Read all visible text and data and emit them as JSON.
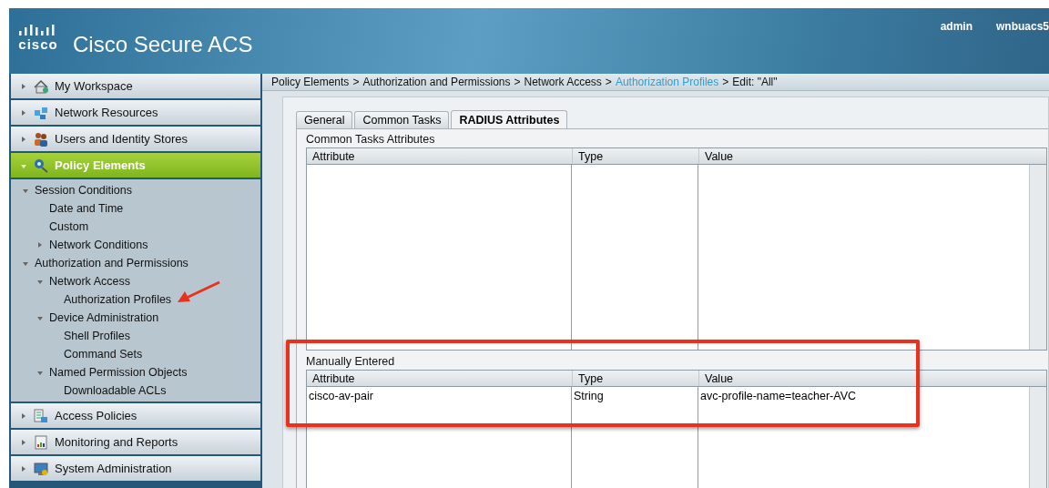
{
  "header": {
    "logo_text": "cisco",
    "title": "Cisco Secure ACS",
    "user": "admin",
    "server": "wnbuacs5"
  },
  "sidebar": {
    "sections": [
      {
        "label": "My Workspace",
        "expanded": false,
        "selected": false
      },
      {
        "label": "Network Resources",
        "expanded": false,
        "selected": false
      },
      {
        "label": "Users and Identity Stores",
        "expanded": false,
        "selected": false
      },
      {
        "label": "Policy Elements",
        "expanded": true,
        "selected": true,
        "children": [
          {
            "label": "Session Conditions",
            "expanded": true,
            "children": [
              {
                "label": "Date and Time"
              },
              {
                "label": "Custom"
              },
              {
                "label": "Network Conditions",
                "expanded": false
              }
            ]
          },
          {
            "label": "Authorization and Permissions",
            "expanded": true,
            "children": [
              {
                "label": "Network Access",
                "expanded": true,
                "children": [
                  {
                    "label": "Authorization Profiles",
                    "pointed": true
                  }
                ]
              },
              {
                "label": "Device Administration",
                "expanded": true,
                "children": [
                  {
                    "label": "Shell Profiles"
                  },
                  {
                    "label": "Command Sets"
                  }
                ]
              },
              {
                "label": "Named Permission Objects",
                "expanded": true,
                "children": [
                  {
                    "label": "Downloadable ACLs"
                  }
                ]
              }
            ]
          }
        ]
      },
      {
        "label": "Access Policies",
        "expanded": false,
        "selected": false
      },
      {
        "label": "Monitoring and Reports",
        "expanded": false,
        "selected": false
      },
      {
        "label": "System Administration",
        "expanded": false,
        "selected": false
      }
    ]
  },
  "breadcrumb": [
    {
      "kind": "text",
      "text": "Policy Elements"
    },
    {
      "kind": "separator",
      "text": ">"
    },
    {
      "kind": "text",
      "text": "Authorization and Permissions"
    },
    {
      "kind": "separator",
      "text": ">"
    },
    {
      "kind": "text",
      "text": "Network Access"
    },
    {
      "kind": "separator",
      "text": ">"
    },
    {
      "kind": "link",
      "text": "Authorization Profiles"
    },
    {
      "kind": "separator",
      "text": ">"
    },
    {
      "kind": "text",
      "text": "Edit: \"All\""
    }
  ],
  "tabs": [
    {
      "label": "General",
      "selected": false
    },
    {
      "label": "Common Tasks",
      "selected": false
    },
    {
      "label": "RADIUS Attributes",
      "selected": true
    }
  ],
  "sections": [
    {
      "title": "Common Tasks Attributes",
      "highlighted": false,
      "columns": [
        "Attribute",
        "Type",
        "Value"
      ]
    },
    {
      "title": "Manually Entered",
      "highlighted": true,
      "columns": [
        "Attribute",
        "Type",
        "Value"
      ],
      "rows": [
        [
          "cisco-av-pair",
          "String",
          "avc-profile-name=teacher-AVC"
        ]
      ]
    }
  ]
}
